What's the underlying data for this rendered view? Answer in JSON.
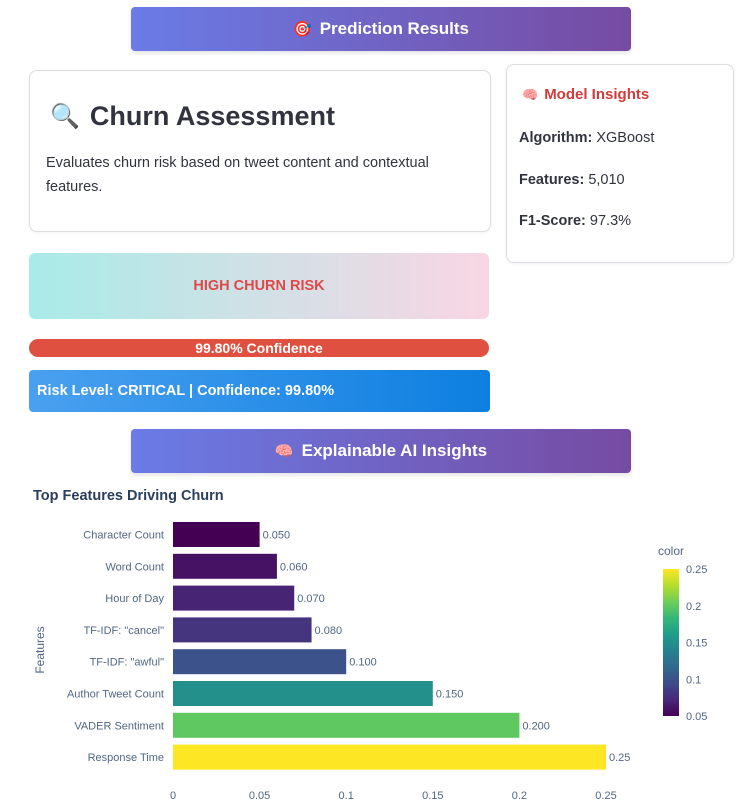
{
  "prediction_banner": {
    "emoji": "🎯",
    "label": "Prediction Results"
  },
  "assessment": {
    "emoji": "🔍",
    "title": "Churn Assessment",
    "description": "Evaluates churn risk based on tweet content and contextual features."
  },
  "insights": {
    "emoji": "🧠",
    "title": "Model Insights",
    "rows": [
      {
        "label": "Algorithm:",
        "value": "XGBoost"
      },
      {
        "label": "Features:",
        "value": "5,010"
      },
      {
        "label": "F1-Score:",
        "value": "97.3%"
      }
    ]
  },
  "risk": {
    "label": "HIGH CHURN RISK",
    "confidence_text": "99.80% Confidence",
    "confidence_value": 99.8,
    "level_text": "Risk Level: CRITICAL | Confidence: 99.80%"
  },
  "xai_banner": {
    "emoji": "🧠",
    "label": "Explainable AI Insights"
  },
  "chart_data": {
    "type": "bar",
    "orientation": "horizontal",
    "title": "Top Features Driving Churn",
    "ylabel": "Features",
    "xlabel": "",
    "categories": [
      "Character Count",
      "Word Count",
      "Hour of Day",
      "TF-IDF: \"cancel\"",
      "TF-IDF: \"awful\"",
      "Author Tweet Count",
      "VADER Sentiment",
      "Response Time"
    ],
    "values": [
      0.05,
      0.06,
      0.07,
      0.08,
      0.1,
      0.15,
      0.2,
      0.25
    ],
    "value_labels": [
      "0.050",
      "0.060",
      "0.070",
      "0.080",
      "0.100",
      "0.150",
      "0.200",
      "0.25"
    ],
    "xticks": [
      "0",
      "0.05",
      "0.1",
      "0.15",
      "0.2",
      "0.25"
    ],
    "xlim": [
      0,
      0.25
    ],
    "colorbar": {
      "title": "color",
      "ticks": [
        "0.25",
        "0.2",
        "0.15",
        "0.1",
        "0.05"
      ],
      "colors": [
        "#440154",
        "#482878",
        "#3e4a89",
        "#31688e",
        "#26828e",
        "#1f9e89",
        "#35b779",
        "#6ece58",
        "#b5de2b",
        "#fde725"
      ],
      "range": [
        0.05,
        0.25
      ]
    }
  }
}
